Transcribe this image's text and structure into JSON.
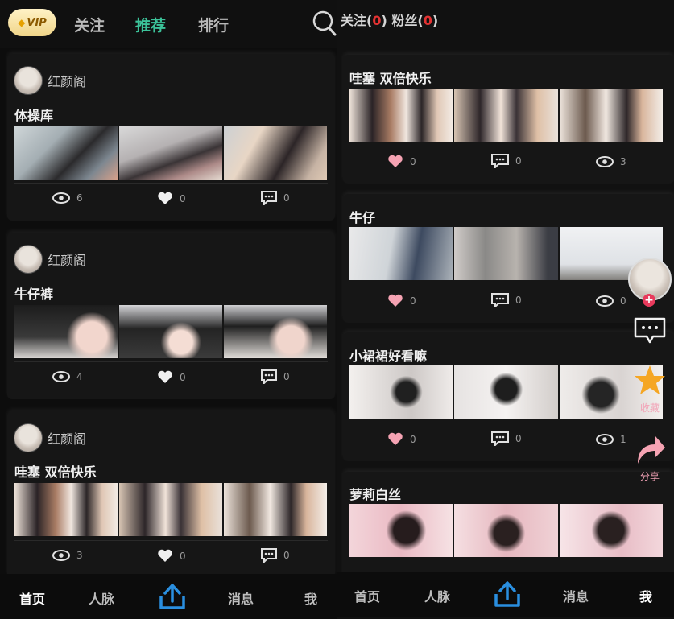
{
  "top_left": {
    "vip_label": "VIP",
    "tabs": [
      "关注",
      "推荐",
      "排行"
    ],
    "active_tab": "推荐"
  },
  "top_right": {
    "follow_label": "关注",
    "follow_count": "0",
    "fans_label": "粉丝",
    "fans_count": "0"
  },
  "left_feed": [
    {
      "author": "红颜阁",
      "title": "体操库",
      "views": "6",
      "likes": "0",
      "comments": "0"
    },
    {
      "author": "红颜阁",
      "title": "牛仔裤",
      "views": "4",
      "likes": "0",
      "comments": "0"
    },
    {
      "author": "红颜阁",
      "title": "哇塞 双倍快乐",
      "views": "3",
      "likes": "0",
      "comments": "0"
    }
  ],
  "right_feed": [
    {
      "title": "哇塞 双倍快乐",
      "likes": "0",
      "comments": "0",
      "views": "3"
    },
    {
      "title": "牛仔",
      "likes": "0",
      "comments": "0",
      "views": "0"
    },
    {
      "title": "小裙裙好看嘛",
      "likes": "0",
      "comments": "0",
      "views": "1"
    },
    {
      "title": "萝莉白丝"
    }
  ],
  "floating": {
    "collect_label": "收藏",
    "share_label": "分享"
  },
  "nav_left": [
    "首页",
    "人脉",
    "消息",
    "我"
  ],
  "nav_left_active": "首页",
  "nav_right": [
    "首页",
    "人脉",
    "消息",
    "我"
  ],
  "nav_right_active": "我",
  "colors": {
    "accent_green": "#3cc39a",
    "count_red": "#e33232",
    "like_pink": "#f5a3b3",
    "upload_blue": "#2a8fe0",
    "star_orange": "#f5a623"
  }
}
